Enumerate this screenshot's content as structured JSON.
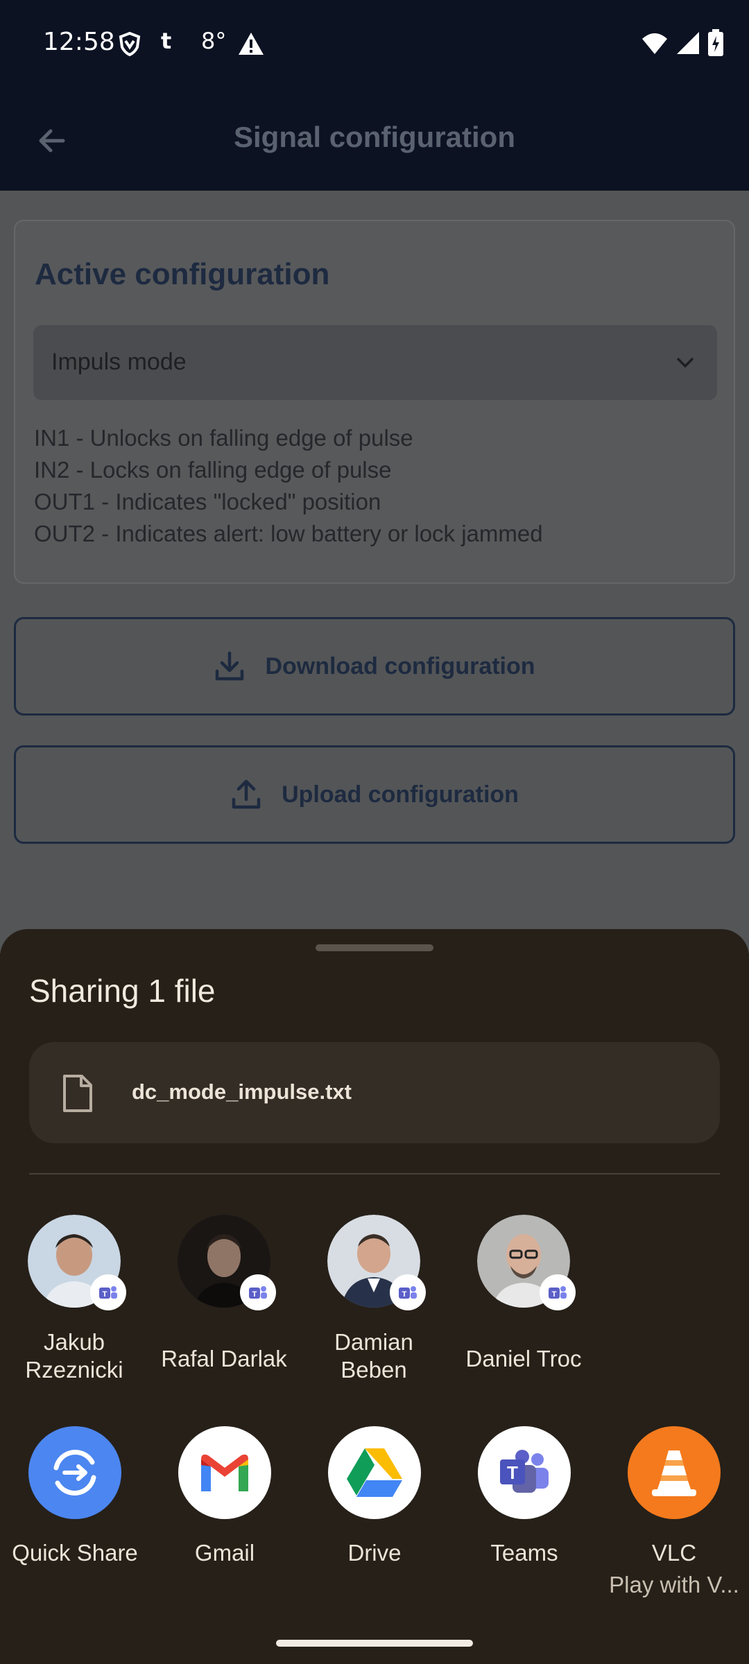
{
  "status_bar": {
    "time": "12:58",
    "temperature": "8°",
    "icons": [
      "vpn-shield-icon",
      "t-app-icon",
      "warning-icon",
      "wifi-icon",
      "signal-icon",
      "battery-icon"
    ]
  },
  "app_bar": {
    "title": "Signal configuration",
    "back_icon": "arrow-back-icon"
  },
  "active_config": {
    "title": "Active configuration",
    "selected_mode": "Impuls mode",
    "description": [
      "IN1 - Unlocks on falling edge of pulse",
      "IN2 - Locks on falling edge of pulse",
      "OUT1 - Indicates \"locked\" position",
      "OUT2 - Indicates alert: low battery or lock jammed"
    ]
  },
  "buttons": {
    "download_label": "Download configuration",
    "upload_label": "Upload configuration"
  },
  "share_sheet": {
    "title": "Sharing 1 file",
    "file_name": "dc_mode_impulse.txt",
    "contacts": [
      {
        "name": "Jakub Rzeznicki",
        "line1": "Jakub",
        "line2": "Rzeznicki",
        "avatar_color": "#c9d6e3"
      },
      {
        "name": "Rafal Darlak",
        "line1": "Rafal Darlak",
        "line2": "",
        "avatar_color": "#1a1614"
      },
      {
        "name": "Damian Beben",
        "line1": "Damian",
        "line2": "Beben",
        "avatar_color": "#d8dde3"
      },
      {
        "name": "Daniel Troc",
        "line1": "Daniel Troc",
        "line2": "",
        "avatar_color": "#b8b8b6"
      }
    ],
    "apps": [
      {
        "name": "Quick Share",
        "sub": "",
        "icon": "quick-share-icon",
        "color": "#4c86f0"
      },
      {
        "name": "Gmail",
        "sub": "",
        "icon": "gmail-icon",
        "color": "#ffffff"
      },
      {
        "name": "Drive",
        "sub": "",
        "icon": "drive-icon",
        "color": "#ffffff"
      },
      {
        "name": "Teams",
        "sub": "",
        "icon": "teams-icon",
        "color": "#ffffff"
      },
      {
        "name": "VLC",
        "sub": "Play with V...",
        "icon": "vlc-icon",
        "color": "#f47a1d"
      }
    ]
  },
  "colors": {
    "header_bg": "#0c1222",
    "sheet_bg": "#262019",
    "accent_navy": "#1d2a40"
  }
}
